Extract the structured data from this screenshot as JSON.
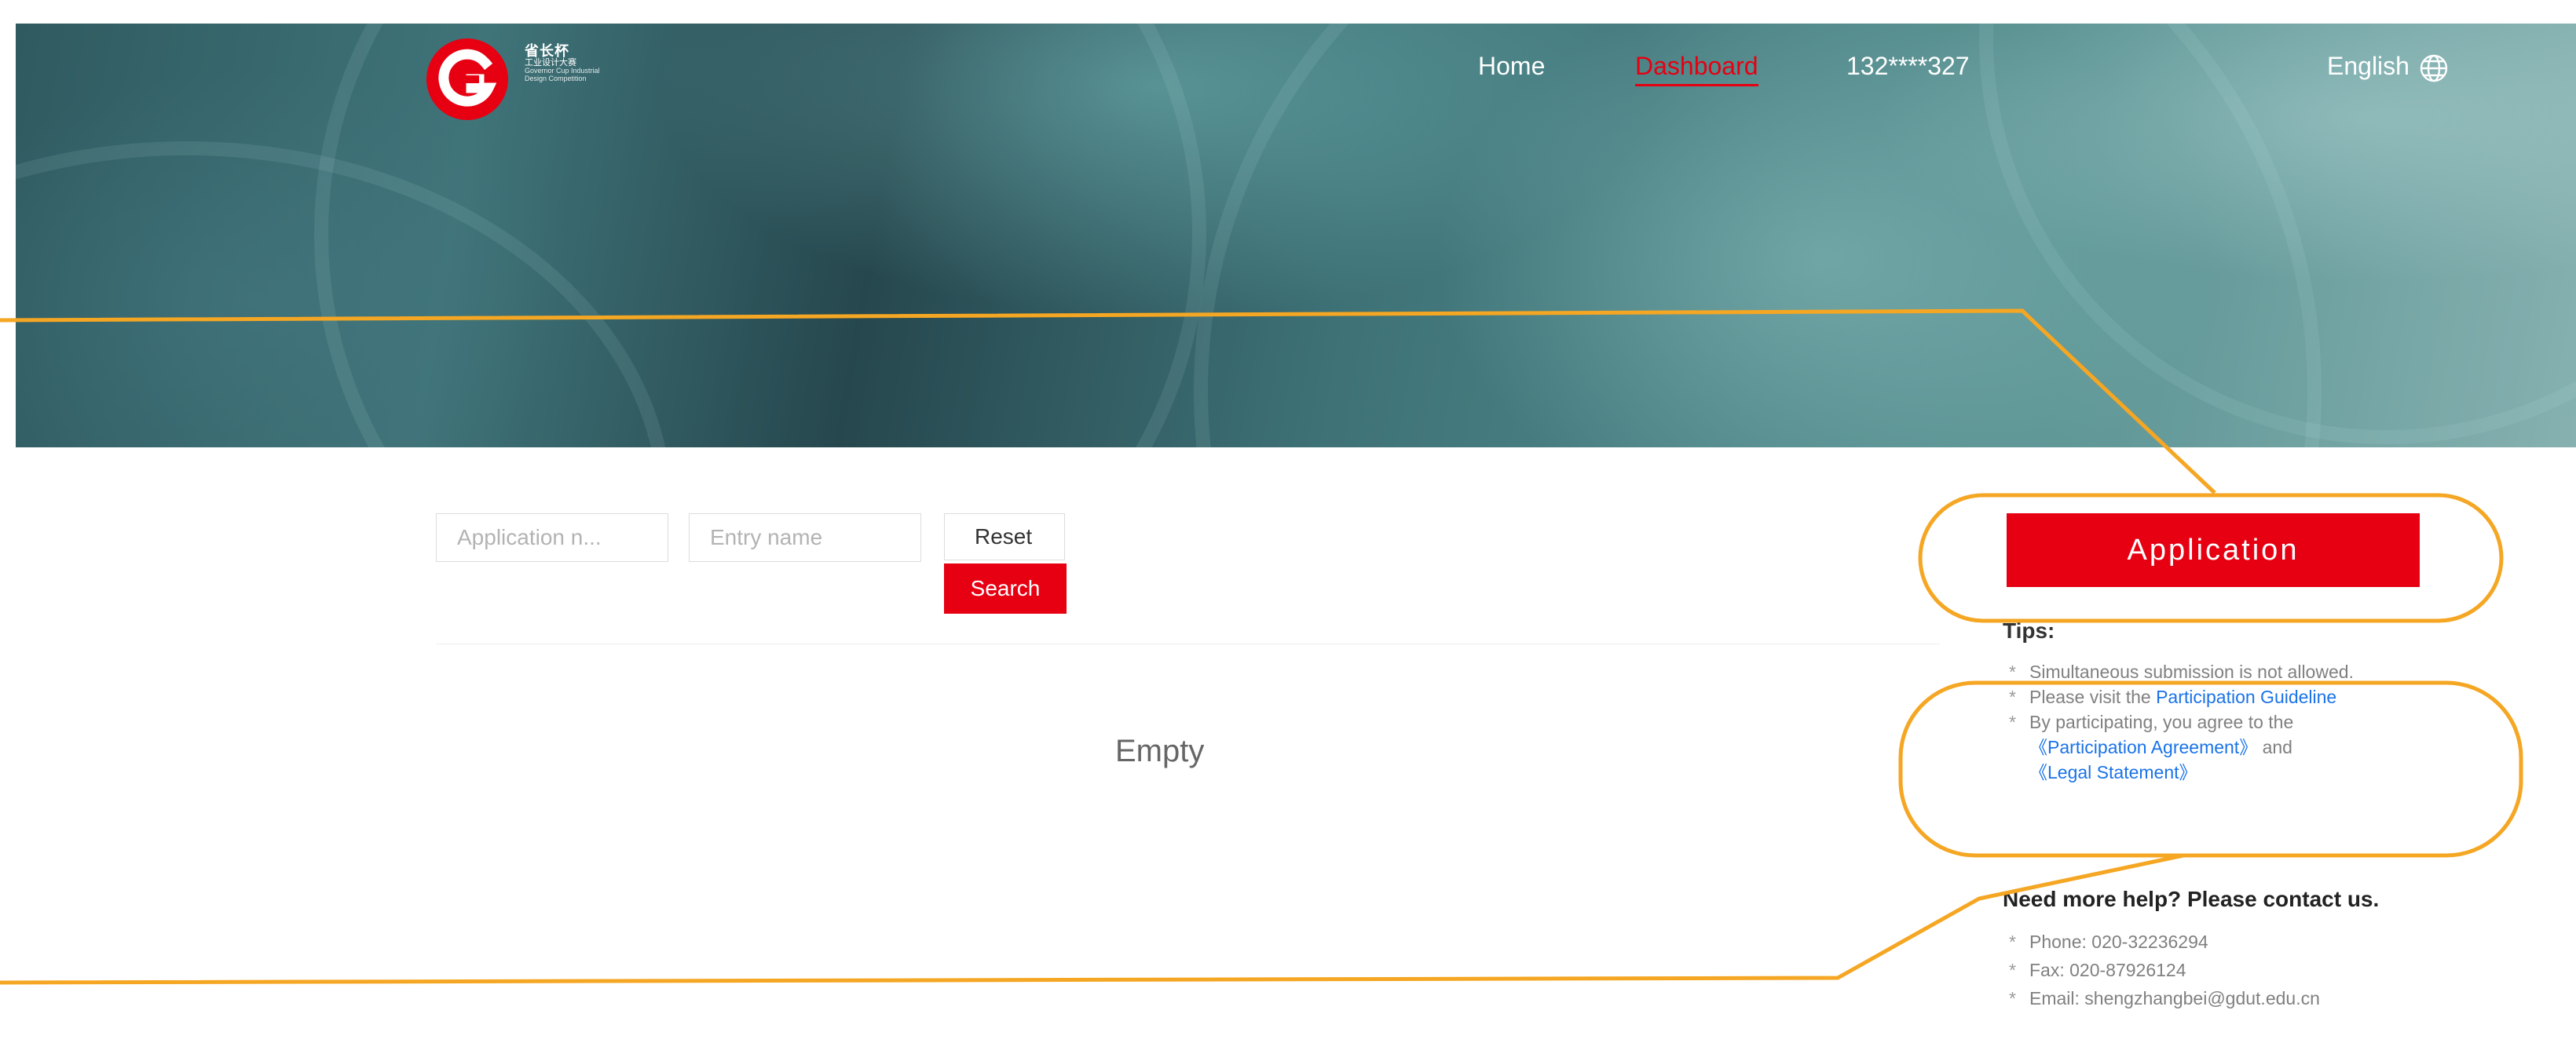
{
  "header": {
    "logo_text_cn_1": "省长杯",
    "logo_text_cn_2": "工业设计大赛",
    "logo_text_en": "Governor Cup Industrial Design Competition",
    "nav": {
      "home": "Home",
      "dashboard": "Dashboard",
      "user": "132****327",
      "language": "English"
    }
  },
  "filters": {
    "application_no_placeholder": "Application n...",
    "entry_name_placeholder": "Entry name",
    "reset_label": "Reset",
    "search_label": "Search"
  },
  "results": {
    "empty_text": "Empty"
  },
  "sidebar": {
    "application_button": "Application",
    "tips_title": "Tips:",
    "tip1": "Simultaneous submission is not allowed.",
    "tip2_prefix": "Please visit the ",
    "tip2_link": "Participation Guideline",
    "tip3_prefix": "By participating, you agree to the",
    "tip3_link1": "《Participation Agreement》",
    "tip3_and": " and",
    "tip3_link2": "《Legal Statement》",
    "help_title": "Need more help? Please contact us.",
    "phone": "Phone: 020-32236294",
    "fax": "Fax: 020-87926124",
    "email": "Email: shengzhangbei@gdut.edu.cn"
  },
  "colors": {
    "brand_red": "#e60012",
    "link_blue": "#1a73e8",
    "annotation_orange": "#f5a623"
  },
  "icons": {
    "logo": "governor-cup-logo-icon",
    "language": "globe-icon"
  }
}
